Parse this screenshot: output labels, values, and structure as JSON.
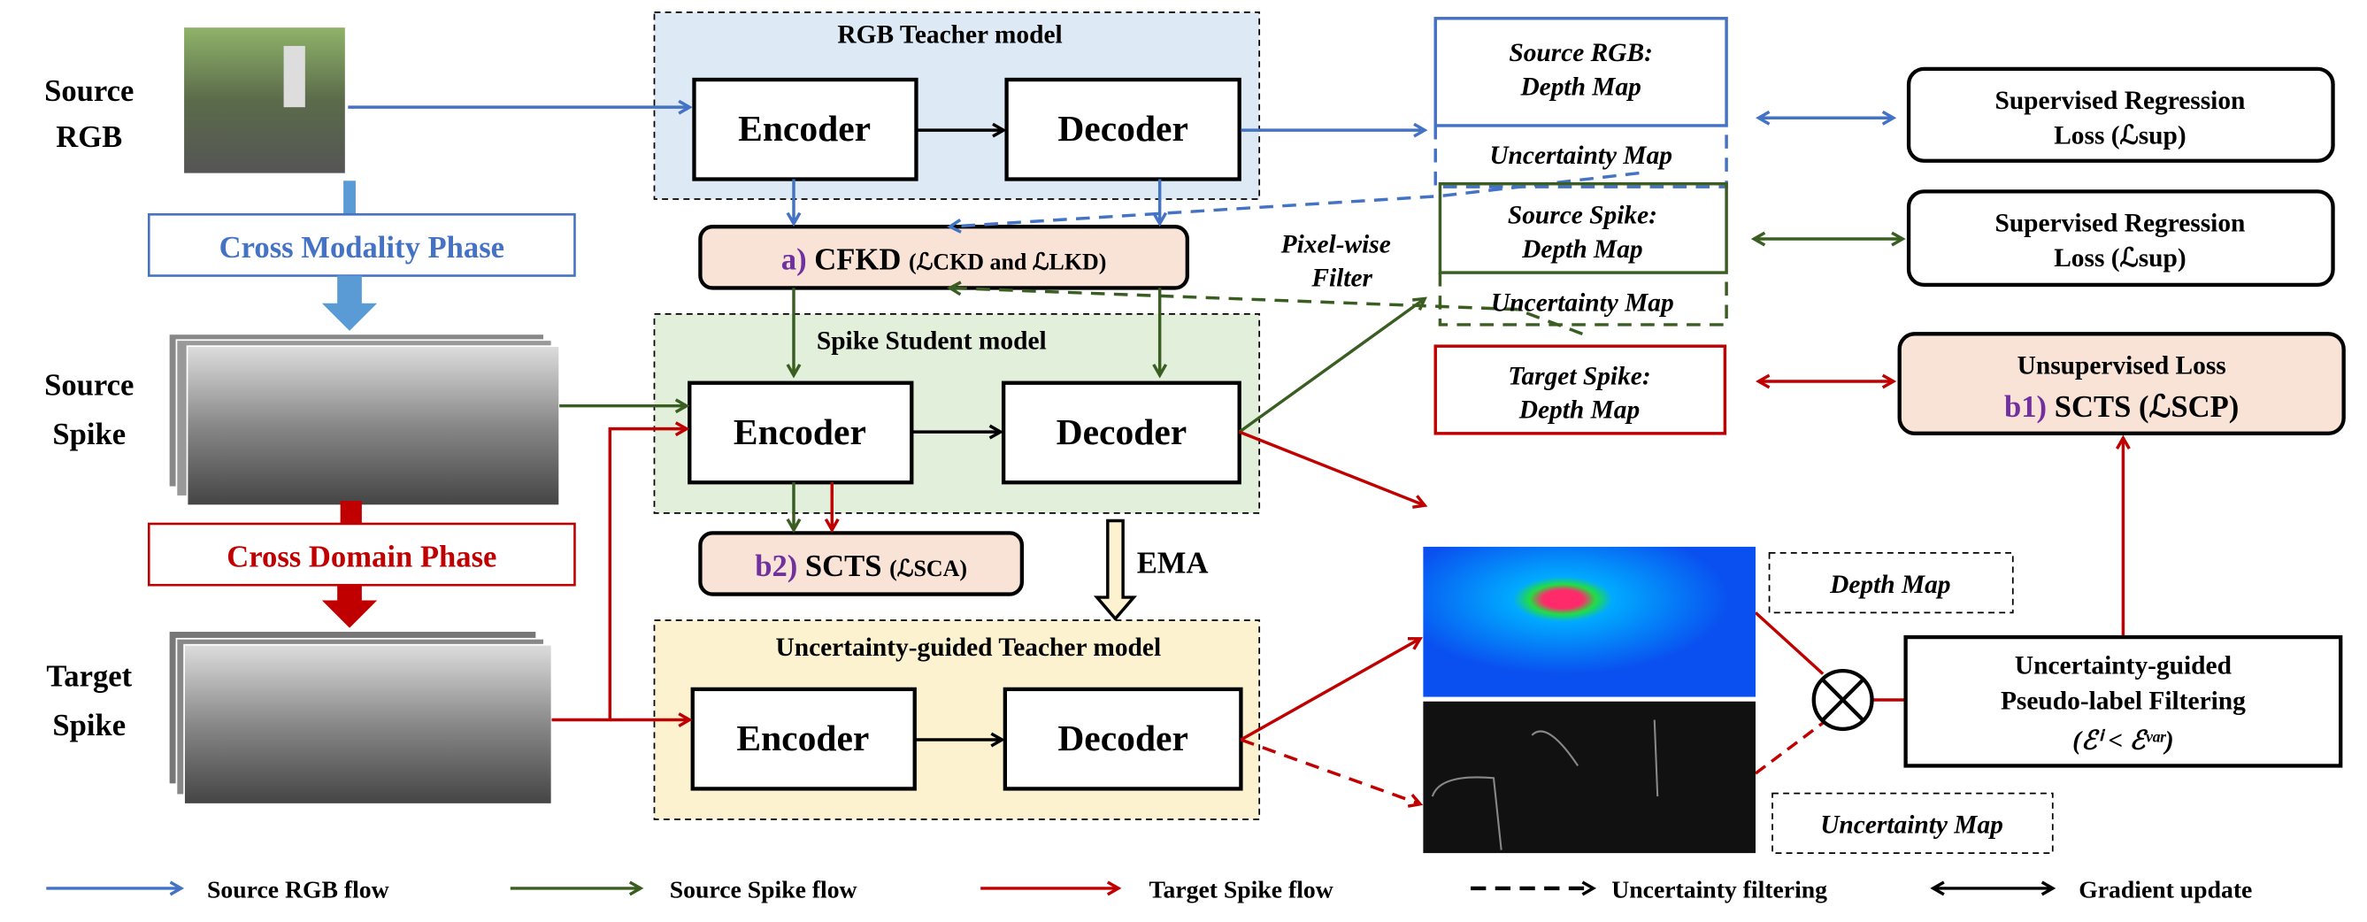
{
  "left": {
    "source_rgb": [
      "Source",
      "RGB"
    ],
    "source_spike": [
      "Source",
      "Spike"
    ],
    "target_spike": [
      "Target",
      "Spike"
    ],
    "cross_modality": "Cross Modality  Phase",
    "cross_domain": "Cross Domain Phase"
  },
  "rgb_teacher": {
    "title": "RGB Teacher  model",
    "encoder": "Encoder",
    "decoder": "Decoder"
  },
  "cfkd": {
    "prefix": "a)",
    "name": "CFKD",
    "loss": "(ℒCKD and ℒLKD)"
  },
  "spike_student": {
    "title": "Spike Student model",
    "encoder": "Encoder",
    "decoder": "Decoder"
  },
  "scts_b2": {
    "prefix": "b2)",
    "name": "SCTS",
    "loss": "(ℒSCA)"
  },
  "ema": "EMA",
  "ug_teacher": {
    "title": "Uncertainty-guided Teacher model",
    "encoder": "Encoder",
    "decoder": "Decoder"
  },
  "pixel_filter": [
    "Pixel-wise",
    "Filter"
  ],
  "outputs": {
    "rgb_depth": [
      "Source RGB:",
      "Depth Map"
    ],
    "rgb_unc": "Uncertainty Map",
    "spike_depth": [
      "Source Spike:",
      "Depth Map"
    ],
    "spike_unc": "Uncertainty Map",
    "target_depth": [
      "Target Spike:",
      "Depth Map"
    ],
    "depth_map_label": "Depth Map",
    "unc_map_label": "Uncertainty Map"
  },
  "losses": {
    "sup1": [
      "Supervised Regression",
      "Loss (ℒsup)"
    ],
    "sup2": [
      "Supervised Regression",
      "Loss (ℒsup)"
    ],
    "unsup": [
      "Unsupervised Loss",
      "b1)",
      "SCTS (ℒSCP)"
    ]
  },
  "filtering": [
    "Uncertainty-guided",
    "Pseudo-label Filtering",
    "(ℰⁱ < ℰᵛᵃʳ)"
  ],
  "legend": [
    "Source RGB flow",
    "Source Spike flow",
    "Target Spike flow",
    "Uncertainty filtering",
    "Gradient update"
  ],
  "colors": {
    "blue": "#4472c4",
    "green": "#3a5e22",
    "red": "#c00000",
    "purple": "#7030a0",
    "teacher_bg": "#dde9f5",
    "student_bg": "#e2efda",
    "ug_bg": "#fdf2d0",
    "loss_bg": "#f9e3d6"
  }
}
